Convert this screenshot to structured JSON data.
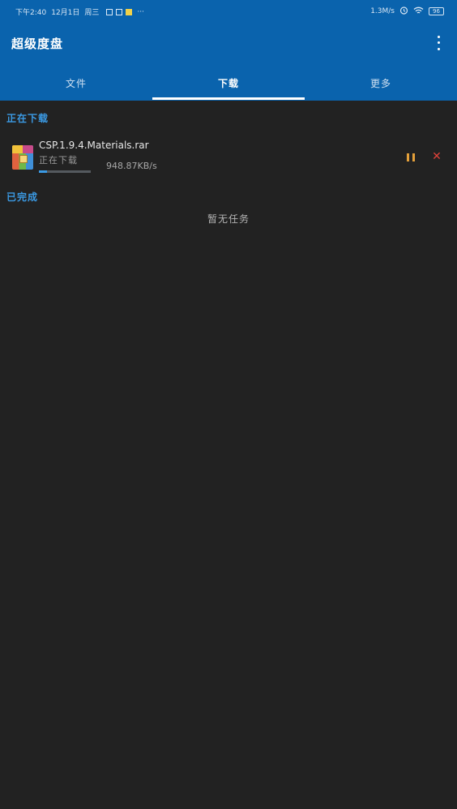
{
  "status_bar": {
    "time": "下午2:40",
    "date": "12月1日",
    "weekday": "周三",
    "more": "···",
    "net_speed": "1.3M/s",
    "battery": "96"
  },
  "app_bar": {
    "title": "超级度盘",
    "menu_icon": "more-vert-icon"
  },
  "tabs": [
    {
      "label": "文件",
      "active": false
    },
    {
      "label": "下载",
      "active": true
    },
    {
      "label": "更多",
      "active": false
    }
  ],
  "downloading": {
    "section_label": "正在下载",
    "items": [
      {
        "file_name": "CSP.1.9.4.Materials.rar",
        "status": "正在下载",
        "speed": "948.87KB/s",
        "progress": 0.15,
        "icon": "archive-file-icon"
      }
    ]
  },
  "completed": {
    "section_label": "已完成",
    "empty_text": "暂无任务"
  },
  "colors": {
    "primary": "#0a63ad",
    "accent": "#3b9ae4",
    "background": "#222222",
    "pause": "#e4a03a",
    "cancel": "#e0423a"
  }
}
